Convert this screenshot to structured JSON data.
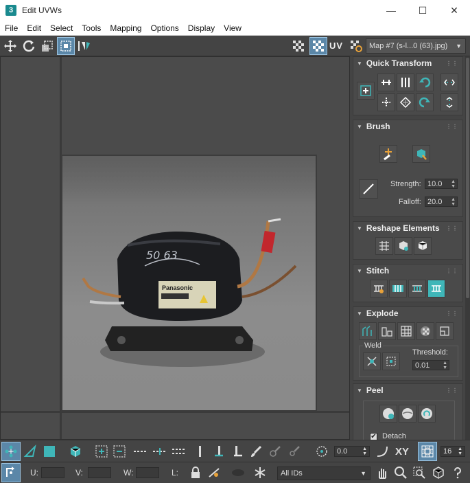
{
  "window": {
    "title": "Edit UVWs",
    "app_icon": "3",
    "minimize": "—",
    "maximize": "☐",
    "close": "✕"
  },
  "menu": [
    "File",
    "Edit",
    "Select",
    "Tools",
    "Mapping",
    "Options",
    "Display",
    "View"
  ],
  "toolbar": {
    "uv_label": "UV",
    "map_select": "Map #7 (s-l...0 (63).jpg)"
  },
  "photo": {
    "label_brand": "Panasonic",
    "marker_text": "50 63"
  },
  "panel": {
    "quick_transform": {
      "title": "Quick Transform"
    },
    "brush": {
      "title": "Brush",
      "strength_label": "Strength:",
      "strength_value": "10.0",
      "falloff_label": "Falloff:",
      "falloff_value": "20.0"
    },
    "reshape": {
      "title": "Reshape Elements"
    },
    "stitch": {
      "title": "Stitch"
    },
    "explode": {
      "title": "Explode",
      "weld_label": "Weld",
      "threshold_label": "Threshold:",
      "threshold_value": "0.01"
    },
    "peel": {
      "title": "Peel",
      "detach_label": "Detach",
      "detach_checked": "✔"
    }
  },
  "bottom": {
    "rotate_value": "0.0",
    "xy_label": "XY",
    "grid_value": "16",
    "u_label": "U:",
    "v_label": "V:",
    "w_label": "W:",
    "l_label": "L:",
    "id_select": "All IDs"
  },
  "colors": {
    "accent": "#3fb6b8",
    "active": "#5b87a8",
    "bg": "#444444"
  }
}
